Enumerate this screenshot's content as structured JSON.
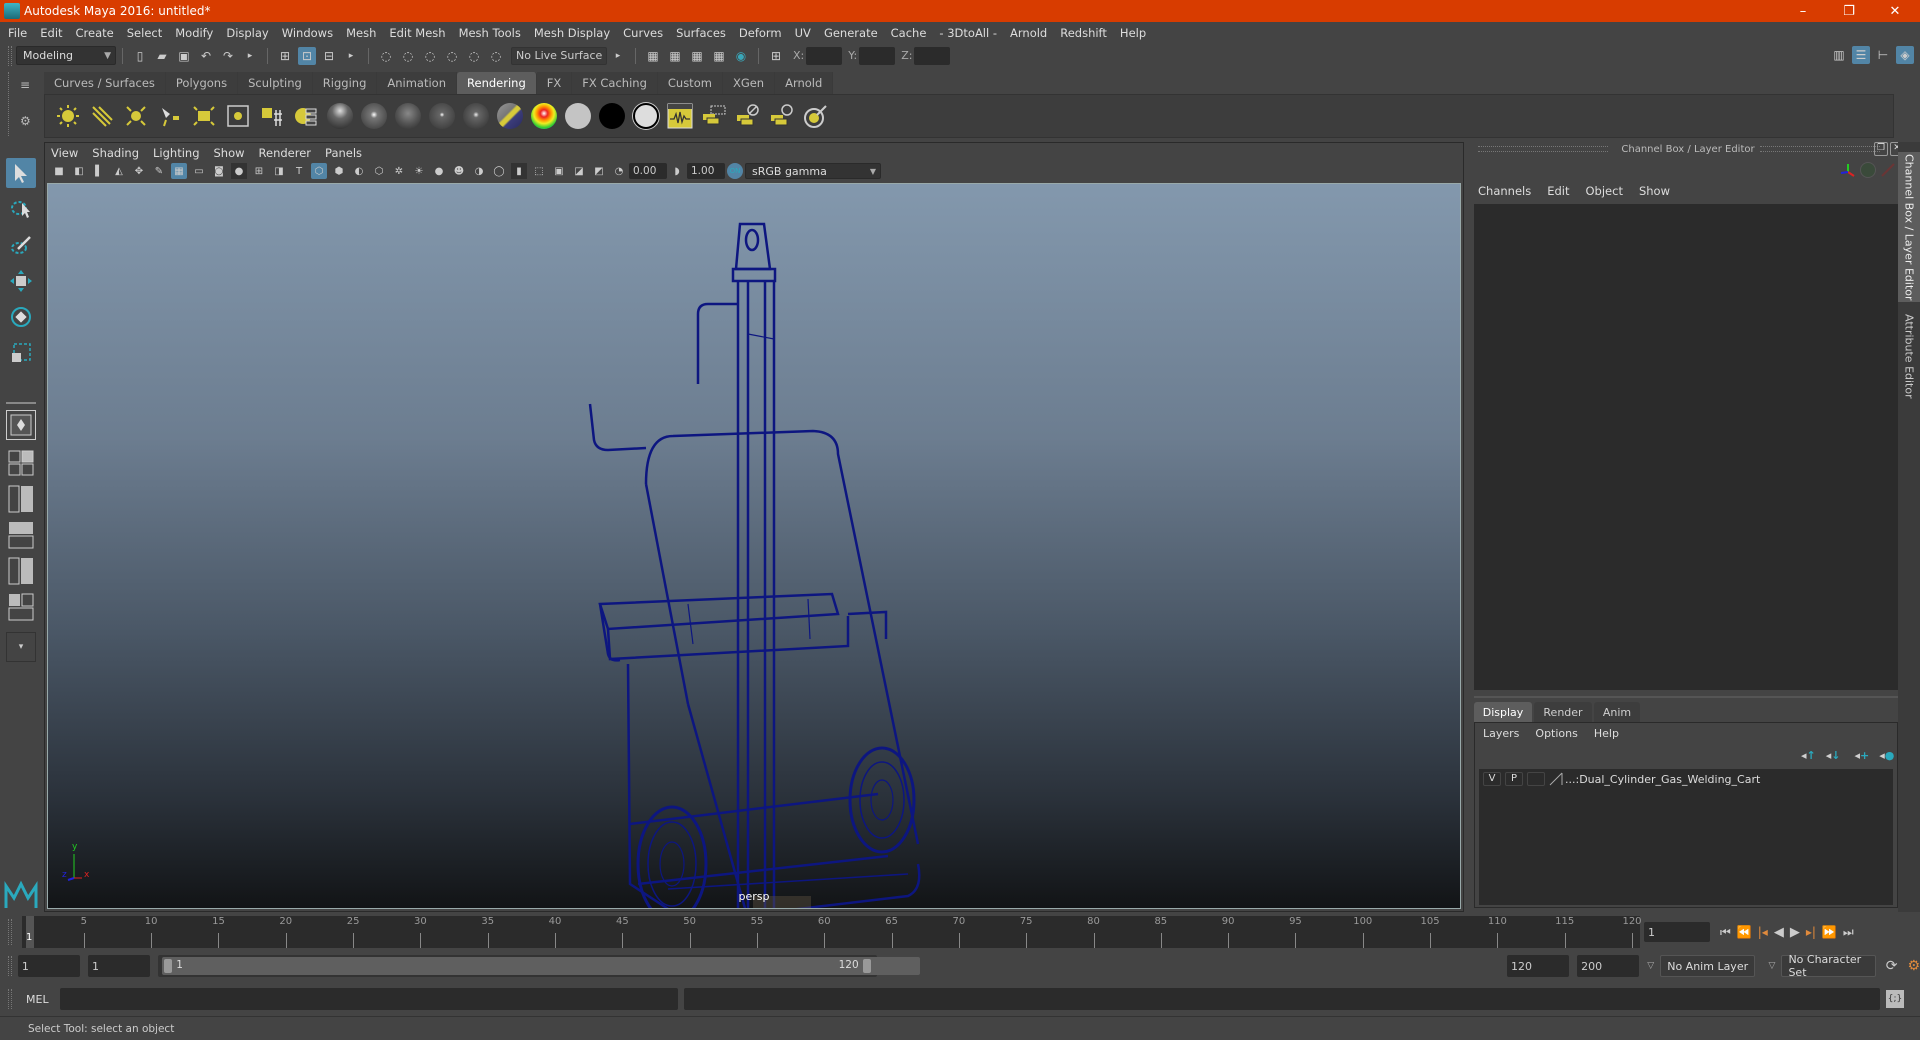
{
  "window": {
    "title": "Autodesk Maya 2016: untitled*",
    "controls": {
      "minimize": "–",
      "restore": "❐",
      "close": "✕"
    }
  },
  "menubar": [
    "File",
    "Edit",
    "Create",
    "Select",
    "Modify",
    "Display",
    "Windows",
    "Mesh",
    "Edit Mesh",
    "Mesh Tools",
    "Mesh Display",
    "Curves",
    "Surfaces",
    "Deform",
    "UV",
    "Generate",
    "Cache",
    "- 3DtoAll -",
    "Arnold",
    "Redshift",
    "Help"
  ],
  "status_line": {
    "mode_menu": "Modeling",
    "live_surface": "No Live Surface",
    "xyz_labels": {
      "x": "X:",
      "y": "Y:",
      "z": "Z:"
    },
    "xyz_values": {
      "x": "",
      "y": "",
      "z": ""
    }
  },
  "shelf": {
    "tabs": [
      "Curves / Surfaces",
      "Polygons",
      "Sculpting",
      "Rigging",
      "Animation",
      "Rendering",
      "FX",
      "FX Caching",
      "Custom",
      "XGen",
      "Arnold"
    ],
    "active_tab": "Rendering",
    "icons": [
      "ambient-light",
      "directional-light",
      "point-light",
      "spot-light",
      "area-light",
      "volume-light",
      "light-link-editor",
      "hypershade",
      "blinn-material",
      "phong-material",
      "lambert-material",
      "phongE-material",
      "anisotropic-material",
      "layered-shader",
      "ramp-shader",
      "surface-shader",
      "use-background",
      "shading-map",
      "render-view",
      "batch-render",
      "render-settings",
      "ipr-render",
      "render-icon"
    ]
  },
  "viewport": {
    "menu": [
      "View",
      "Shading",
      "Lighting",
      "Show",
      "Renderer",
      "Panels"
    ],
    "exposure": "0.00",
    "gamma": "1.00",
    "color_space": "sRGB gamma",
    "camera_label": "persp",
    "axis": {
      "x": "x",
      "y": "y",
      "z": "z"
    },
    "wire_color": "#0d1680"
  },
  "channel_box": {
    "title": "Channel Box / Layer Editor",
    "menu": [
      "Channels",
      "Edit",
      "Object",
      "Show"
    ]
  },
  "layer_editor": {
    "tabs": [
      "Display",
      "Render",
      "Anim"
    ],
    "active_tab": "Display",
    "menu": [
      "Layers",
      "Options",
      "Help"
    ],
    "layers": [
      {
        "visible": "V",
        "playback": "P",
        "name": "...:Dual_Cylinder_Gas_Welding_Cart"
      }
    ]
  },
  "side_tabs": [
    "Channel Box / Layer Editor",
    "Attribute Editor"
  ],
  "timeline": {
    "start": 1,
    "end": 120,
    "current_frame_marker": "1",
    "tick_labels": [
      5,
      10,
      15,
      20,
      25,
      30,
      35,
      40,
      45,
      50,
      55,
      60,
      65,
      70,
      75,
      80,
      85,
      90,
      95,
      100,
      105,
      110,
      115,
      120
    ],
    "current_frame_field": "1"
  },
  "range": {
    "start_field": "1",
    "playback_start": "1",
    "slider_start": "1",
    "slider_end": "120",
    "playback_end": "120",
    "end_field": "200",
    "anim_layer": "No Anim Layer",
    "character_set": "No Character Set"
  },
  "command_line": {
    "label": "MEL",
    "value": "",
    "result": ""
  },
  "help_line": "Select Tool: select an object",
  "colors": {
    "titlebar": "#d83c00",
    "accent": "#5285a6"
  }
}
